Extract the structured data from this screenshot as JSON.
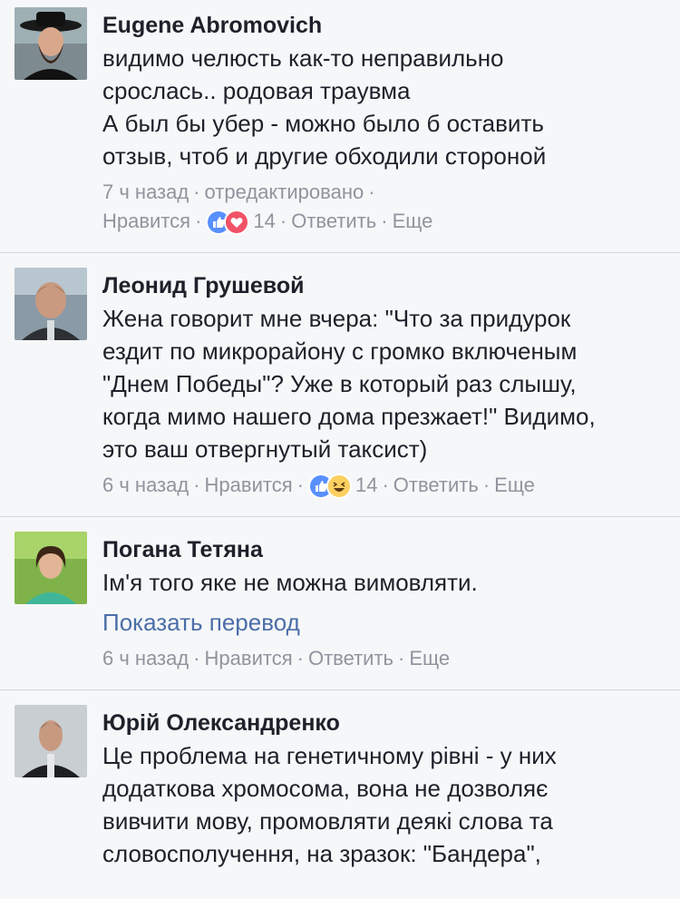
{
  "comments": [
    {
      "author": "Eugene Abromovich",
      "lines": [
        "видимо челюсть как-то неправильно",
        "срослась.. родовая траувма",
        "А был бы убер - можно было б оставить",
        "отзыв, чтоб и другие обходили стороной"
      ],
      "time": "7 ч назад",
      "edited": "отредактировано",
      "like": "Нравится",
      "reaction_count": "14",
      "reactions": [
        "like-icon",
        "love-icon"
      ],
      "reply": "Ответить",
      "more": "Еще"
    },
    {
      "author": "Леонид Грушевой",
      "lines": [
        "Жена говорит мне вчера: \"Что за придурок",
        "ездит по микрорайону с громко включеным",
        "\"Днем Победы\"? Уже в который раз слышу,",
        "когда мимо нашего дома презжает!\" Видимо,",
        "это ваш отвергнутый таксист)"
      ],
      "time": "6 ч назад",
      "like": "Нравится",
      "reaction_count": "14",
      "reactions": [
        "like-icon",
        "haha-icon"
      ],
      "reply": "Ответить",
      "more": "Еще"
    },
    {
      "author": "Погана Тетяна",
      "lines": [
        "Ім'я того яке не можна вимовляти."
      ],
      "translate": "Показать перевод",
      "time": "6 ч назад",
      "like": "Нравится",
      "reply": "Ответить",
      "more": "Еще"
    },
    {
      "author": "Юрій Олександренко",
      "lines": [
        "Це проблема на генетичному рівні - у них",
        "додаткова хромосома, вона не дозволяє",
        "вивчити мову, промовляти деякі слова та",
        "словосполучення, на зразок: \"Бандера\","
      ]
    }
  ],
  "separator": "·",
  "colors": {
    "text": "#1d2129",
    "meta": "#90949c",
    "link": "#4b6ea8",
    "like_blue": "#5890ff",
    "love_red": "#f25268",
    "haha_yellow": "#fcd060",
    "background": "#f6f7f9",
    "divider": "#d4d6da"
  }
}
